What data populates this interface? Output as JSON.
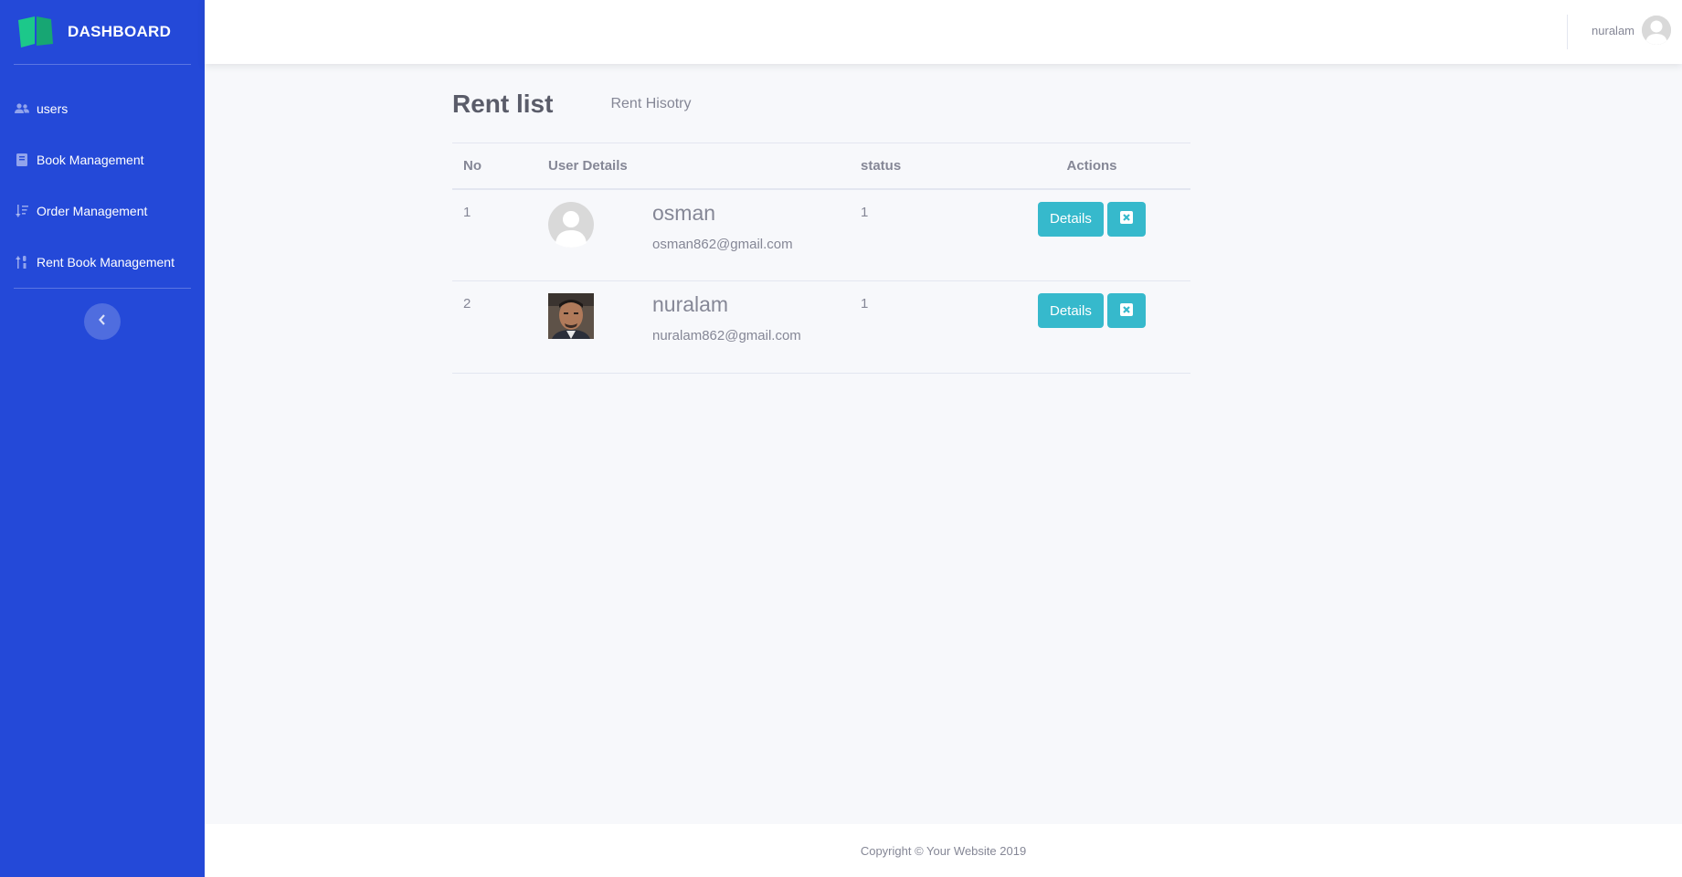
{
  "sidebar": {
    "brand": "DASHBOARD",
    "brand_icon": "book-open-icon",
    "items": [
      {
        "label": "users",
        "icon": "users-icon"
      },
      {
        "label": "Book Management",
        "icon": "book-icon"
      },
      {
        "label": "Order Management",
        "icon": "sort-amount-icon"
      },
      {
        "label": "Rent Book Management",
        "icon": "sort-numeric-icon"
      }
    ],
    "toggle_icon": "chevron-left-icon"
  },
  "topbar": {
    "username": "nuralam"
  },
  "main": {
    "title": "Rent list",
    "history_link": "Rent Hisotry",
    "table": {
      "headers": [
        "No",
        "User Details",
        "",
        "status",
        "Actions"
      ],
      "rows": [
        {
          "no": "1",
          "name": "osman",
          "email": "osman862@gmail.com",
          "status": "1",
          "details_label": "Details",
          "photo": "default-avatar"
        },
        {
          "no": "2",
          "name": "nuralam",
          "email": "nuralam862@gmail.com",
          "status": "1",
          "details_label": "Details",
          "photo": "user-photo"
        }
      ]
    }
  },
  "footer": {
    "copyright": "Copyright © Your Website 2019"
  },
  "colors": {
    "sidebar": "#2449d8",
    "accent": "#36b9cc",
    "logo": "#1cc88a"
  }
}
